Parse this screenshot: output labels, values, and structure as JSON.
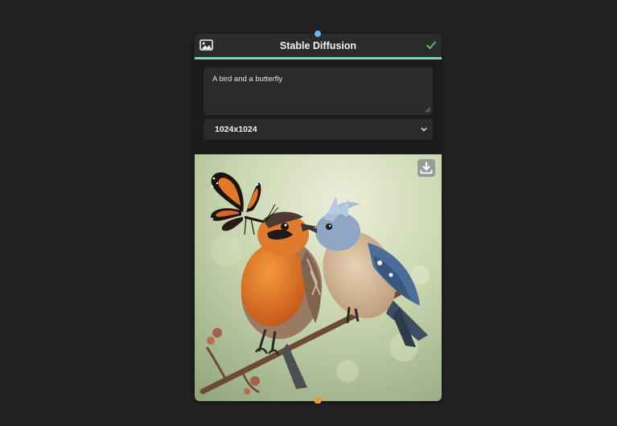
{
  "node": {
    "title": "Stable Diffusion",
    "header_accent_color": "#78d6c0",
    "status_icon": "check-icon",
    "type_icon": "image-icon",
    "prompt_text": "A bird and a butterfly",
    "size_selected": "1024x1024",
    "output_image": "generated-image",
    "download_icon": "download-icon"
  },
  "colors": {
    "background": "#222222",
    "node_body": "#1b1b1b",
    "input_handle": "#6ab6f0",
    "output_handle": "#e0a030",
    "check": "#5fc05f"
  }
}
